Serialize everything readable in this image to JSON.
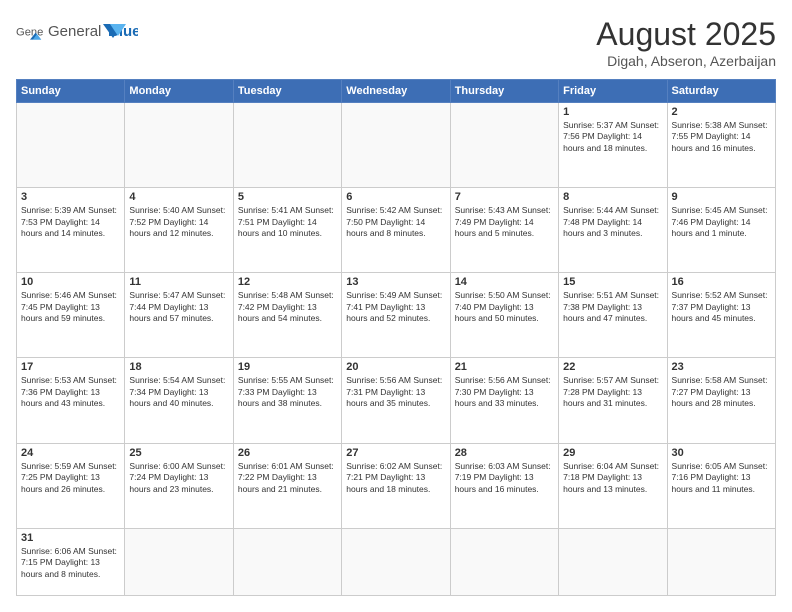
{
  "header": {
    "logo_general": "General",
    "logo_blue": "Blue",
    "month_year": "August 2025",
    "location": "Digah, Abseron, Azerbaijan"
  },
  "weekdays": [
    "Sunday",
    "Monday",
    "Tuesday",
    "Wednesday",
    "Thursday",
    "Friday",
    "Saturday"
  ],
  "weeks": [
    [
      {
        "day": "",
        "info": ""
      },
      {
        "day": "",
        "info": ""
      },
      {
        "day": "",
        "info": ""
      },
      {
        "day": "",
        "info": ""
      },
      {
        "day": "",
        "info": ""
      },
      {
        "day": "1",
        "info": "Sunrise: 5:37 AM\nSunset: 7:56 PM\nDaylight: 14 hours\nand 18 minutes."
      },
      {
        "day": "2",
        "info": "Sunrise: 5:38 AM\nSunset: 7:55 PM\nDaylight: 14 hours\nand 16 minutes."
      }
    ],
    [
      {
        "day": "3",
        "info": "Sunrise: 5:39 AM\nSunset: 7:53 PM\nDaylight: 14 hours\nand 14 minutes."
      },
      {
        "day": "4",
        "info": "Sunrise: 5:40 AM\nSunset: 7:52 PM\nDaylight: 14 hours\nand 12 minutes."
      },
      {
        "day": "5",
        "info": "Sunrise: 5:41 AM\nSunset: 7:51 PM\nDaylight: 14 hours\nand 10 minutes."
      },
      {
        "day": "6",
        "info": "Sunrise: 5:42 AM\nSunset: 7:50 PM\nDaylight: 14 hours\nand 8 minutes."
      },
      {
        "day": "7",
        "info": "Sunrise: 5:43 AM\nSunset: 7:49 PM\nDaylight: 14 hours\nand 5 minutes."
      },
      {
        "day": "8",
        "info": "Sunrise: 5:44 AM\nSunset: 7:48 PM\nDaylight: 14 hours\nand 3 minutes."
      },
      {
        "day": "9",
        "info": "Sunrise: 5:45 AM\nSunset: 7:46 PM\nDaylight: 14 hours\nand 1 minute."
      }
    ],
    [
      {
        "day": "10",
        "info": "Sunrise: 5:46 AM\nSunset: 7:45 PM\nDaylight: 13 hours\nand 59 minutes."
      },
      {
        "day": "11",
        "info": "Sunrise: 5:47 AM\nSunset: 7:44 PM\nDaylight: 13 hours\nand 57 minutes."
      },
      {
        "day": "12",
        "info": "Sunrise: 5:48 AM\nSunset: 7:42 PM\nDaylight: 13 hours\nand 54 minutes."
      },
      {
        "day": "13",
        "info": "Sunrise: 5:49 AM\nSunset: 7:41 PM\nDaylight: 13 hours\nand 52 minutes."
      },
      {
        "day": "14",
        "info": "Sunrise: 5:50 AM\nSunset: 7:40 PM\nDaylight: 13 hours\nand 50 minutes."
      },
      {
        "day": "15",
        "info": "Sunrise: 5:51 AM\nSunset: 7:38 PM\nDaylight: 13 hours\nand 47 minutes."
      },
      {
        "day": "16",
        "info": "Sunrise: 5:52 AM\nSunset: 7:37 PM\nDaylight: 13 hours\nand 45 minutes."
      }
    ],
    [
      {
        "day": "17",
        "info": "Sunrise: 5:53 AM\nSunset: 7:36 PM\nDaylight: 13 hours\nand 43 minutes."
      },
      {
        "day": "18",
        "info": "Sunrise: 5:54 AM\nSunset: 7:34 PM\nDaylight: 13 hours\nand 40 minutes."
      },
      {
        "day": "19",
        "info": "Sunrise: 5:55 AM\nSunset: 7:33 PM\nDaylight: 13 hours\nand 38 minutes."
      },
      {
        "day": "20",
        "info": "Sunrise: 5:56 AM\nSunset: 7:31 PM\nDaylight: 13 hours\nand 35 minutes."
      },
      {
        "day": "21",
        "info": "Sunrise: 5:56 AM\nSunset: 7:30 PM\nDaylight: 13 hours\nand 33 minutes."
      },
      {
        "day": "22",
        "info": "Sunrise: 5:57 AM\nSunset: 7:28 PM\nDaylight: 13 hours\nand 31 minutes."
      },
      {
        "day": "23",
        "info": "Sunrise: 5:58 AM\nSunset: 7:27 PM\nDaylight: 13 hours\nand 28 minutes."
      }
    ],
    [
      {
        "day": "24",
        "info": "Sunrise: 5:59 AM\nSunset: 7:25 PM\nDaylight: 13 hours\nand 26 minutes."
      },
      {
        "day": "25",
        "info": "Sunrise: 6:00 AM\nSunset: 7:24 PM\nDaylight: 13 hours\nand 23 minutes."
      },
      {
        "day": "26",
        "info": "Sunrise: 6:01 AM\nSunset: 7:22 PM\nDaylight: 13 hours\nand 21 minutes."
      },
      {
        "day": "27",
        "info": "Sunrise: 6:02 AM\nSunset: 7:21 PM\nDaylight: 13 hours\nand 18 minutes."
      },
      {
        "day": "28",
        "info": "Sunrise: 6:03 AM\nSunset: 7:19 PM\nDaylight: 13 hours\nand 16 minutes."
      },
      {
        "day": "29",
        "info": "Sunrise: 6:04 AM\nSunset: 7:18 PM\nDaylight: 13 hours\nand 13 minutes."
      },
      {
        "day": "30",
        "info": "Sunrise: 6:05 AM\nSunset: 7:16 PM\nDaylight: 13 hours\nand 11 minutes."
      }
    ],
    [
      {
        "day": "31",
        "info": "Sunrise: 6:06 AM\nSunset: 7:15 PM\nDaylight: 13 hours\nand 8 minutes."
      },
      {
        "day": "",
        "info": ""
      },
      {
        "day": "",
        "info": ""
      },
      {
        "day": "",
        "info": ""
      },
      {
        "day": "",
        "info": ""
      },
      {
        "day": "",
        "info": ""
      },
      {
        "day": "",
        "info": ""
      }
    ]
  ]
}
